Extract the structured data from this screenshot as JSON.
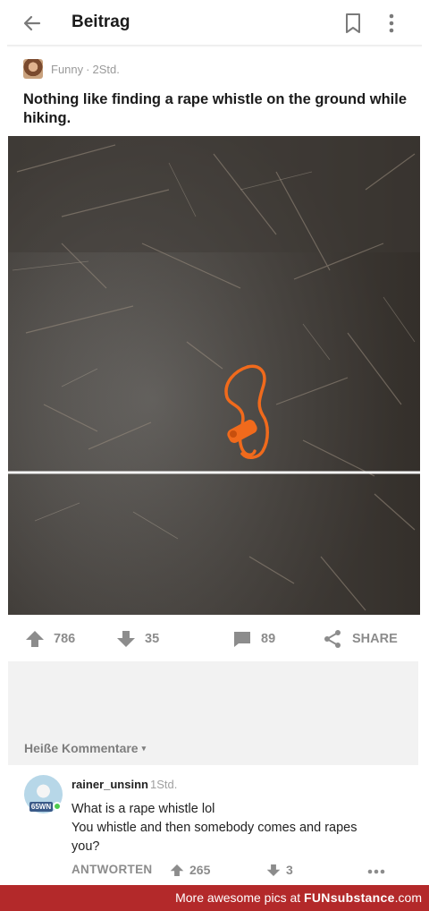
{
  "topbar": {
    "title": "Beitrag",
    "back_icon": "arrow-left-icon",
    "bookmark_icon": "bookmark-icon",
    "more_icon": "more-vertical-icon"
  },
  "post": {
    "category": "Funny",
    "separator": "·",
    "age": "2Std.",
    "title": "Nothing like finding a rape whistle on the ground while hiking.",
    "image_alt": "orange whistle on lanyard lying on forest ground",
    "upvotes": "786",
    "downvotes": "35",
    "comments": "89",
    "share_label": "SHARE"
  },
  "comments_section": {
    "header": "Heiße Kommentare",
    "caret": "▾"
  },
  "comment": {
    "username": "rainer_unsinn",
    "time": "1Std.",
    "badge": "65WN",
    "lines": [
      "What is a rape whistle lol",
      "You whistle and then somebody comes and rapes",
      "you?"
    ],
    "reply_label": "ANTWORTEN",
    "upvotes": "265",
    "downvotes": "3"
  },
  "footer": {
    "prefix": "More awesome pics at",
    "brand": "FUNsubstance",
    "suffix": ".com"
  },
  "colors": {
    "footer_bg": "#b3292a",
    "whistle_orange": "#f06a1c",
    "icon_gray": "#8c8c8c"
  }
}
